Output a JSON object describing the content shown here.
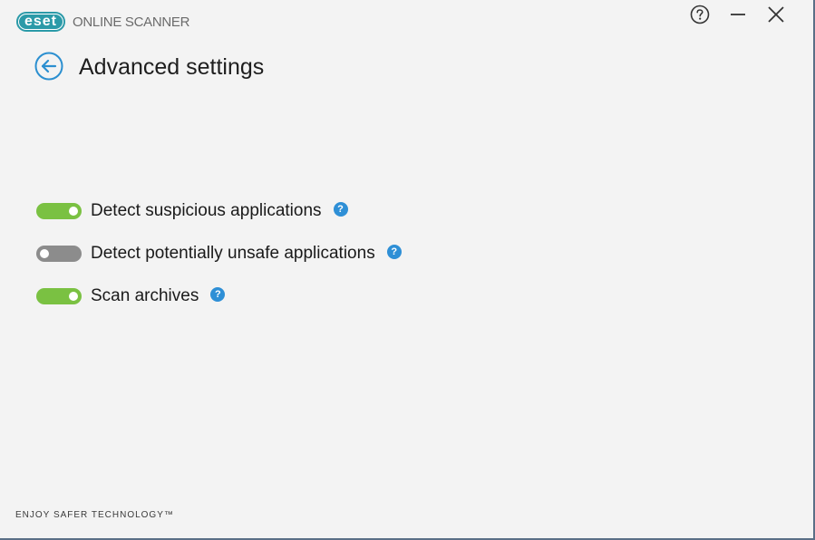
{
  "header": {
    "logo_text": "eset",
    "product_name": "ONLINE SCANNER",
    "window_controls": {
      "help_icon": "question-circle-icon",
      "minimize_icon": "minimize-icon",
      "close_icon": "close-icon"
    }
  },
  "page": {
    "back_icon": "arrow-left-circle-icon",
    "title": "Advanced settings"
  },
  "settings": [
    {
      "label": "Detect suspicious applications",
      "enabled": true,
      "help": "?"
    },
    {
      "label": "Detect potentially unsafe applications",
      "enabled": false,
      "help": "?"
    },
    {
      "label": "Scan archives",
      "enabled": true,
      "help": "?"
    }
  ],
  "footer": {
    "tagline": "ENJOY SAFER TECHNOLOGY™"
  },
  "colors": {
    "toggle_on": "#7ac142",
    "toggle_off": "#8c8c8c",
    "accent": "#2b9aa8",
    "help_blue": "#2e8fd6"
  }
}
